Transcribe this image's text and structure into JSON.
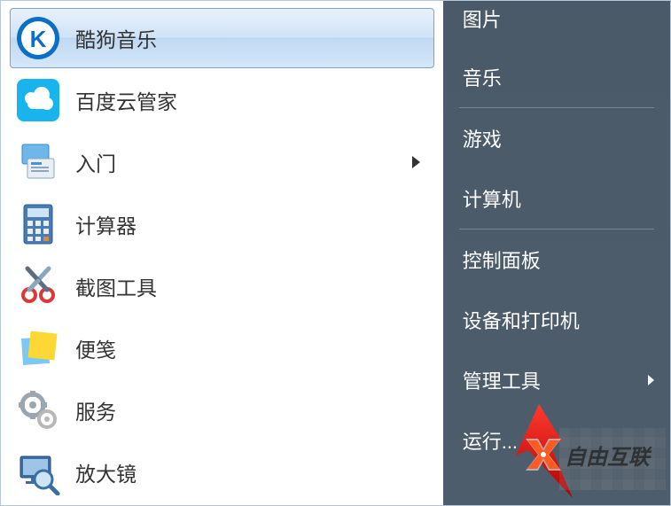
{
  "leftPanel": {
    "items": [
      {
        "id": "kugou",
        "label": "酷狗音乐",
        "selected": true,
        "hasSubmenu": false
      },
      {
        "id": "baidu-cloud",
        "label": "百度云管家",
        "selected": false,
        "hasSubmenu": false
      },
      {
        "id": "getting-started",
        "label": "入门",
        "selected": false,
        "hasSubmenu": true
      },
      {
        "id": "calculator",
        "label": "计算器",
        "selected": false,
        "hasSubmenu": false
      },
      {
        "id": "snipping-tool",
        "label": "截图工具",
        "selected": false,
        "hasSubmenu": false
      },
      {
        "id": "sticky-notes",
        "label": "便笺",
        "selected": false,
        "hasSubmenu": false
      },
      {
        "id": "services",
        "label": "服务",
        "selected": false,
        "hasSubmenu": false
      },
      {
        "id": "magnifier",
        "label": "放大镜",
        "selected": false,
        "hasSubmenu": false
      }
    ]
  },
  "rightPanel": {
    "items": [
      {
        "id": "pictures",
        "label": "图片",
        "hasSubmenu": false,
        "separatorAfter": false
      },
      {
        "id": "music",
        "label": "音乐",
        "hasSubmenu": false,
        "separatorAfter": true
      },
      {
        "id": "games",
        "label": "游戏",
        "hasSubmenu": false,
        "separatorAfter": false
      },
      {
        "id": "computer",
        "label": "计算机",
        "hasSubmenu": false,
        "separatorAfter": true
      },
      {
        "id": "control-panel",
        "label": "控制面板",
        "hasSubmenu": false,
        "separatorAfter": false
      },
      {
        "id": "devices-printers",
        "label": "设备和打印机",
        "hasSubmenu": false,
        "separatorAfter": false
      },
      {
        "id": "admin-tools",
        "label": "管理工具",
        "hasSubmenu": true,
        "separatorAfter": false
      },
      {
        "id": "run",
        "label": "运行...",
        "hasSubmenu": false,
        "separatorAfter": false
      }
    ]
  },
  "watermark": {
    "text": "自由互联"
  }
}
